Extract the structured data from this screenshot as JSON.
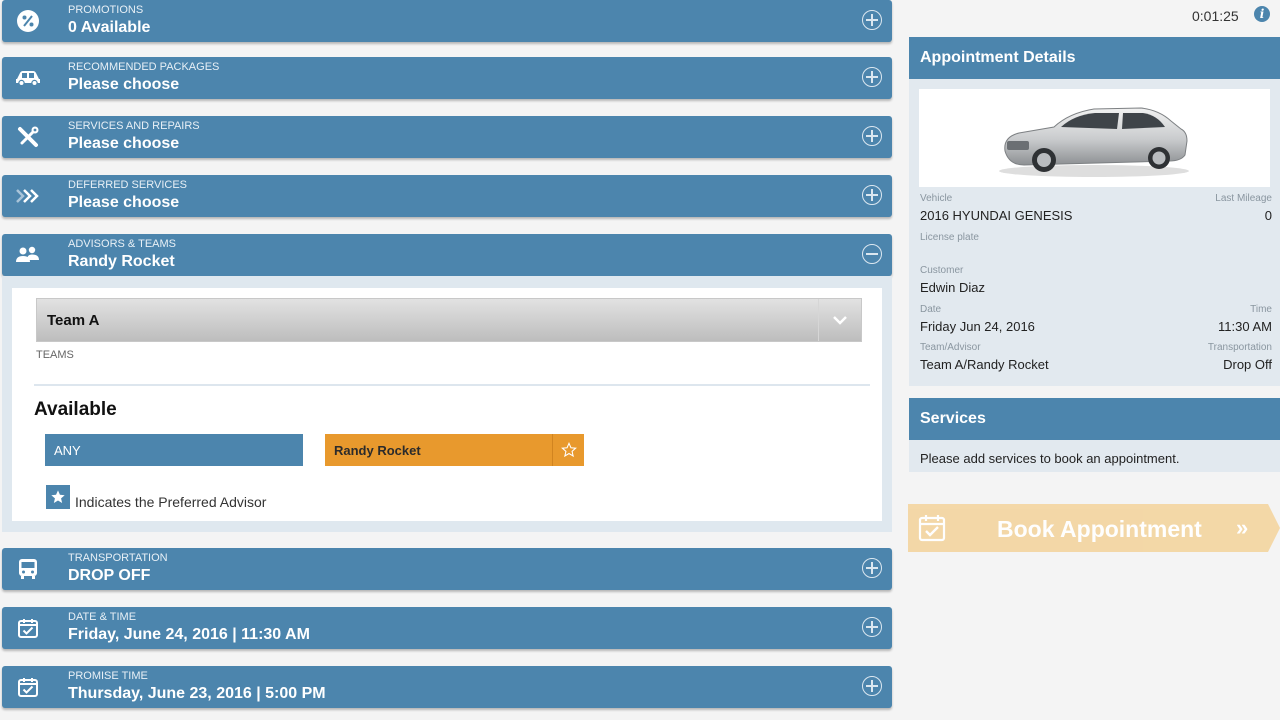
{
  "panels": [
    {
      "label": "PROMOTIONS",
      "value": "0 Available",
      "icon": "percent-icon"
    },
    {
      "label": "RECOMMENDED PACKAGES",
      "value": "Please choose",
      "icon": "car-icon"
    },
    {
      "label": "SERVICES AND REPAIRS",
      "value": "Please choose",
      "icon": "wrench-icon"
    },
    {
      "label": "DEFERRED SERVICES",
      "value": "Please choose",
      "icon": "double-chevron-icon"
    },
    {
      "label": "ADVISORS & TEAMS",
      "value": "Randy Rocket",
      "icon": "people-icon"
    },
    {
      "label": "TRANSPORTATION",
      "value": "DROP OFF",
      "icon": "bus-icon"
    },
    {
      "label": "DATE & TIME",
      "value": "Friday, June 24, 2016 | 11:30 AM",
      "icon": "calendar-icon"
    },
    {
      "label": "PROMISE TIME",
      "value": "Thursday, June 23, 2016 | 5:00 PM",
      "icon": "calendar-icon"
    }
  ],
  "advisors": {
    "team_select": "Team A",
    "teams_label": "TEAMS",
    "available_heading": "Available",
    "any_label": "ANY",
    "advisor_name": "Randy Rocket",
    "legend_text": "Indicates the Preferred Advisor"
  },
  "timer": "0:01:25",
  "appointment": {
    "title": "Appointment Details",
    "vehicle_label": "Vehicle",
    "vehicle": "2016 HYUNDAI GENESIS",
    "mileage_label": "Last Mileage",
    "mileage": "0",
    "plate_label": "License plate",
    "customer_label": "Customer",
    "customer": "Edwin Diaz",
    "date_label": "Date",
    "date": "Friday Jun 24, 2016",
    "time_label": "Time",
    "time": "11:30 AM",
    "team_label": "Team/Advisor",
    "team": "Team A/Randy Rocket",
    "transport_label": "Transportation",
    "transport": "Drop Off"
  },
  "services": {
    "title": "Services",
    "message": "Please add services to book an appointment."
  },
  "book_button": "Book Appointment",
  "colors": {
    "primary": "#4c85ad",
    "accent": "#e8992d",
    "book": "#f3d6a3"
  }
}
